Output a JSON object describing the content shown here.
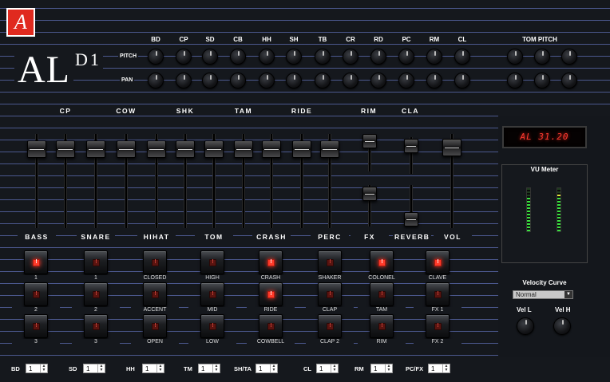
{
  "brand": {
    "logo_letter": "A",
    "name": "AL",
    "model": "D1"
  },
  "top": {
    "pitch_label": "PITCH",
    "pan_label": "PAN",
    "instruments": [
      "BD",
      "CP",
      "SD",
      "CB",
      "HH",
      "SH",
      "TB",
      "CR",
      "RD",
      "PC",
      "RM",
      "CL"
    ],
    "tom_pitch_label": "TOM PITCH"
  },
  "mixer": {
    "upper_labels": [
      "CP",
      "COW",
      "SHK",
      "TAM",
      "RIDE",
      "RIM",
      "CLA"
    ],
    "lower_labels": [
      "BASS",
      "SNARE",
      "HIHAT",
      "TOM",
      "CRASH",
      "PERC",
      "FX",
      "REVERB",
      "VOL"
    ]
  },
  "pads": {
    "row1": [
      {
        "label": "1",
        "on": true
      },
      {
        "label": "1",
        "on": false
      },
      {
        "label": "CLOSED",
        "on": false
      },
      {
        "label": "HIGH",
        "on": false
      },
      {
        "label": "CRASH",
        "on": true
      },
      {
        "label": "SHAKER",
        "on": false
      },
      {
        "label": "COLONEL",
        "on": true
      },
      {
        "label": "CLAVE",
        "on": true
      }
    ],
    "row2": [
      {
        "label": "2",
        "on": false
      },
      {
        "label": "2",
        "on": false
      },
      {
        "label": "ACCENT",
        "on": false
      },
      {
        "label": "MID",
        "on": false
      },
      {
        "label": "RIDE",
        "on": true
      },
      {
        "label": "CLAP",
        "on": false
      },
      {
        "label": "TAM",
        "on": false
      },
      {
        "label": "FX 1",
        "on": false
      }
    ],
    "row3": [
      {
        "label": "3",
        "on": false
      },
      {
        "label": "3",
        "on": false
      },
      {
        "label": "OPEN",
        "on": false
      },
      {
        "label": "LOW",
        "on": false
      },
      {
        "label": "COWBELL",
        "on": false
      },
      {
        "label": "CLAP 2",
        "on": false
      },
      {
        "label": "RIM",
        "on": false
      },
      {
        "label": "FX 2",
        "on": false
      }
    ]
  },
  "display": {
    "text": "AL 31.20"
  },
  "vu": {
    "title": "VU Meter",
    "left_level": 0.82,
    "right_level": 0.85
  },
  "velocity": {
    "title": "Velocity Curve",
    "selected": "Normal",
    "vel_l_label": "Vel L",
    "vel_h_label": "Vel H"
  },
  "footer": {
    "items": [
      {
        "label": "BD",
        "value": "1"
      },
      {
        "label": "SD",
        "value": "1"
      },
      {
        "label": "HH",
        "value": "1"
      },
      {
        "label": "TM",
        "value": "1"
      },
      {
        "label": "SH/TA",
        "value": "1"
      },
      {
        "label": "CL",
        "value": "1"
      },
      {
        "label": "RM",
        "value": "1"
      },
      {
        "label": "PC/FX",
        "value": "1"
      }
    ]
  },
  "colors": {
    "accent_red": "#e02a1f",
    "led_on": "#ff3b2a",
    "stripe": "#788ceb",
    "lcd_text": "#ff3a30"
  }
}
